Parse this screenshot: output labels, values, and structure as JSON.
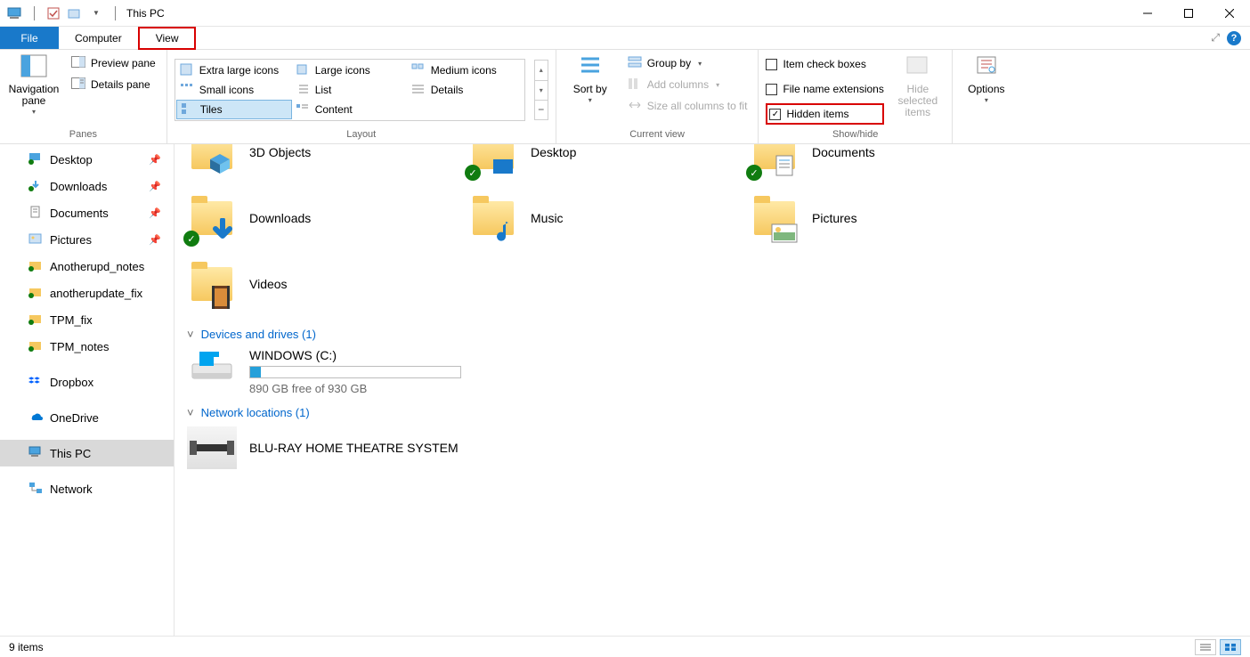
{
  "titlebar": {
    "title": "This PC"
  },
  "tabs": {
    "file": "File",
    "computer": "Computer",
    "view": "View"
  },
  "ribbon": {
    "panes": {
      "group_label": "Panes",
      "navigation": "Navigation pane",
      "preview": "Preview pane",
      "details": "Details pane"
    },
    "layout": {
      "group_label": "Layout",
      "items": [
        "Extra large icons",
        "Large icons",
        "Medium icons",
        "Small icons",
        "List",
        "Details",
        "Tiles",
        "Content"
      ]
    },
    "current_view": {
      "group_label": "Current view",
      "sort_by": "Sort by",
      "group_by": "Group by",
      "add_columns": "Add columns",
      "size_all": "Size all columns to fit"
    },
    "show_hide": {
      "group_label": "Show/hide",
      "item_check": "Item check boxes",
      "file_ext": "File name extensions",
      "hidden": "Hidden items",
      "hide_selected": "Hide selected items"
    },
    "options": {
      "label": "Options"
    }
  },
  "nav": {
    "items": [
      {
        "label": "Desktop",
        "icon": "desktop",
        "pinned": true
      },
      {
        "label": "Downloads",
        "icon": "downloads",
        "pinned": true
      },
      {
        "label": "Documents",
        "icon": "documents",
        "pinned": true
      },
      {
        "label": "Pictures",
        "icon": "pictures",
        "pinned": true
      },
      {
        "label": "Anotherupd_notes",
        "icon": "folder-sync",
        "pinned": false
      },
      {
        "label": "anotherupdate_fix",
        "icon": "folder-sync",
        "pinned": false
      },
      {
        "label": "TPM_fix",
        "icon": "folder-sync",
        "pinned": false
      },
      {
        "label": "TPM_notes",
        "icon": "folder-sync",
        "pinned": false
      }
    ],
    "dropbox": "Dropbox",
    "onedrive": "OneDrive",
    "thispc": "This PC",
    "network": "Network"
  },
  "content": {
    "folders_header_cut": {
      "f1": "3D Objects",
      "f2": "Desktop",
      "f3": "Documents"
    },
    "folders_row2": [
      {
        "label": "Downloads",
        "overlay": "arrow"
      },
      {
        "label": "Music",
        "overlay": "note"
      },
      {
        "label": "Pictures",
        "overlay": "photo"
      }
    ],
    "folders_row3": [
      {
        "label": "Videos",
        "overlay": "film"
      }
    ],
    "devices_header": "Devices and drives (1)",
    "drive": {
      "name": "WINDOWS (C:)",
      "sub": "890 GB free of 930 GB"
    },
    "netloc_header": "Network locations (1)",
    "netloc_item": "BLU-RAY HOME THEATRE SYSTEM"
  },
  "status": {
    "text": "9 items"
  }
}
